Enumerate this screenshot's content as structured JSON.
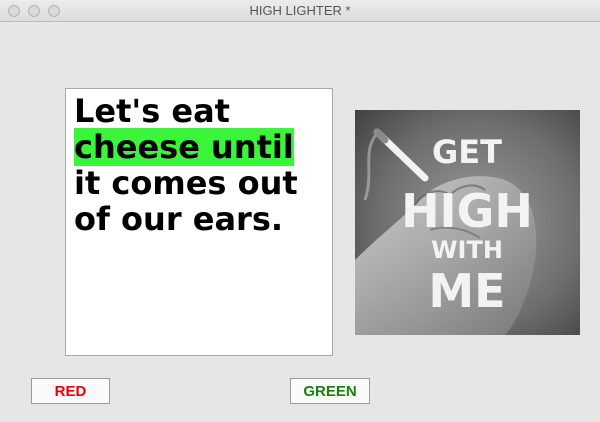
{
  "window": {
    "title": "HIGH LIGHTER *"
  },
  "text_panel": {
    "before": "Let's eat ",
    "highlight": "cheese until",
    "after": " it comes out of our ears.",
    "highlight_color": "#3bf53b"
  },
  "image": {
    "lines": [
      "GET",
      "HIGH",
      "WITH",
      "ME"
    ]
  },
  "buttons": {
    "red_label": "RED",
    "red_color": "#e8000b",
    "green_label": "GREEN",
    "green_color": "#1a7f0e"
  }
}
